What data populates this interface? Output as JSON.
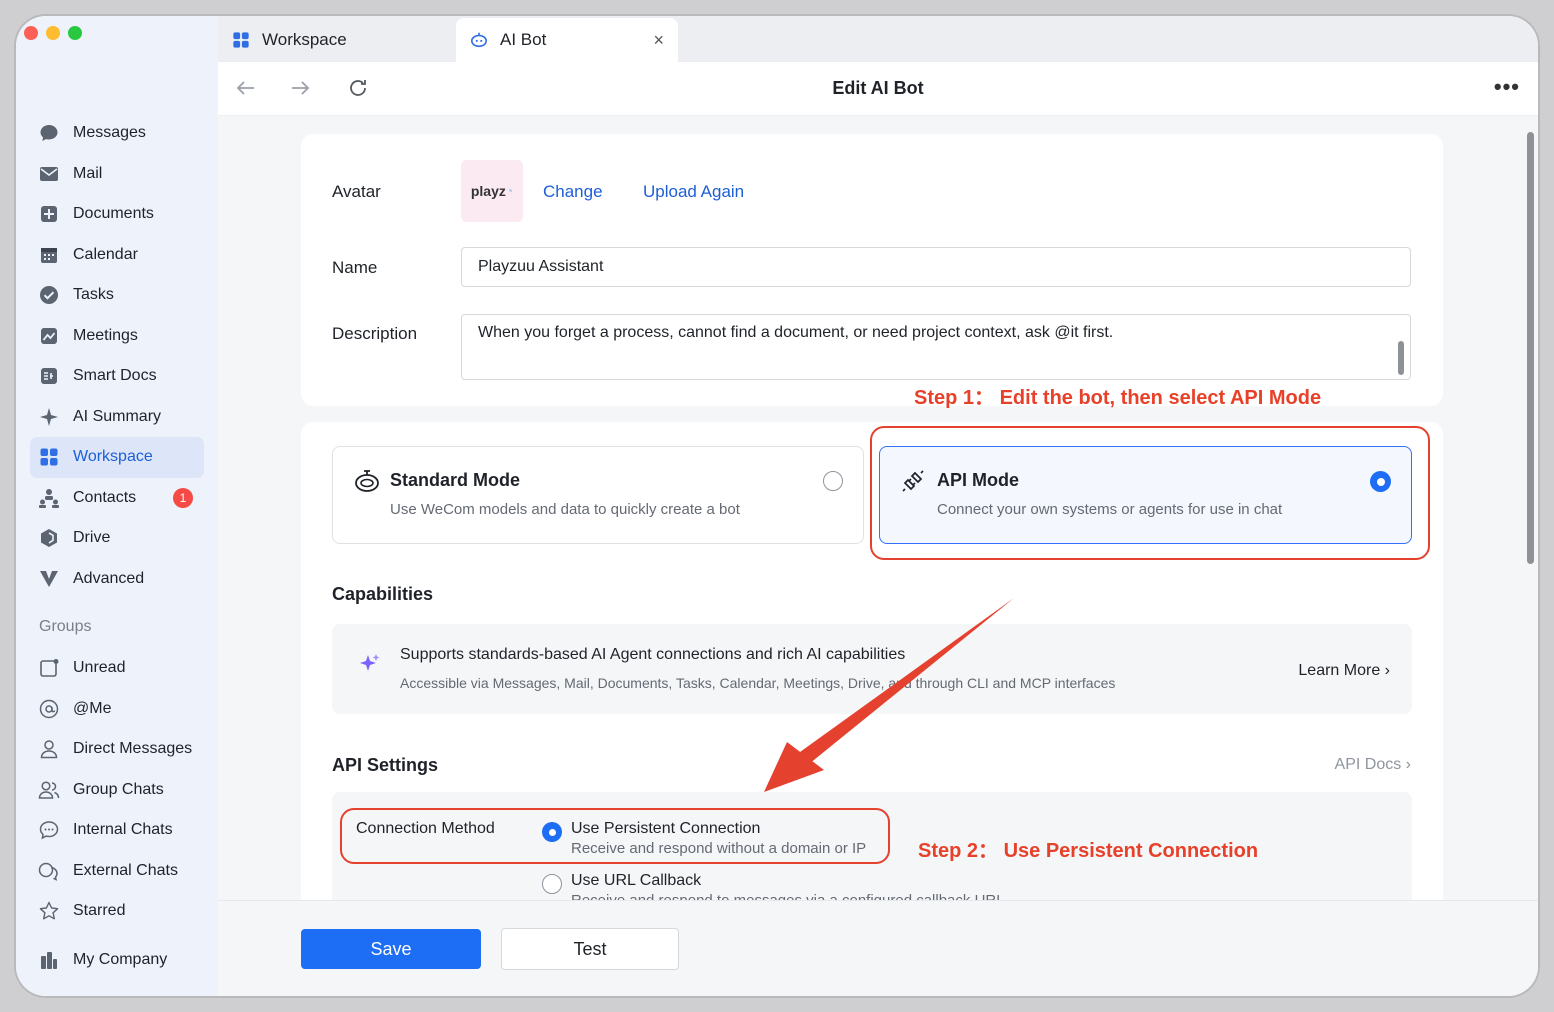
{
  "tabs": [
    {
      "label": "Workspace",
      "icon": "grid-icon"
    },
    {
      "label": "AI Bot",
      "icon": "bot-icon",
      "close": "×"
    }
  ],
  "toolbar": {
    "title": "Edit AI Bot",
    "more": "•••"
  },
  "sidebar": {
    "items": [
      {
        "label": "Messages",
        "icon": "chat-bubble-icon"
      },
      {
        "label": "Mail",
        "icon": "mail-icon"
      },
      {
        "label": "Documents",
        "icon": "document-icon"
      },
      {
        "label": "Calendar",
        "icon": "calendar-icon"
      },
      {
        "label": "Tasks",
        "icon": "check-circle-icon"
      },
      {
        "label": "Meetings",
        "icon": "meetings-icon"
      },
      {
        "label": "Smart Docs",
        "icon": "smart-docs-icon"
      },
      {
        "label": "AI Summary",
        "icon": "sparkle-icon"
      },
      {
        "label": "Workspace",
        "icon": "grid-icon",
        "active": true
      },
      {
        "label": "Contacts",
        "icon": "contacts-icon",
        "badge": "1"
      },
      {
        "label": "Drive",
        "icon": "drive-icon"
      },
      {
        "label": "Advanced",
        "icon": "advanced-icon"
      }
    ],
    "groups_title": "Groups",
    "groups": [
      {
        "label": "Unread",
        "icon": "unread-icon"
      },
      {
        "label": "@Me",
        "icon": "at-icon"
      },
      {
        "label": "Direct Messages",
        "icon": "person-icon"
      },
      {
        "label": "Group Chats",
        "icon": "people-icon"
      },
      {
        "label": "Internal Chats",
        "icon": "chat-dots-icon"
      },
      {
        "label": "External Chats",
        "icon": "external-chat-icon"
      },
      {
        "label": "Starred",
        "icon": "star-icon"
      }
    ],
    "company": {
      "label": "My Company",
      "icon": "company-icon"
    }
  },
  "form": {
    "avatar_label": "Avatar",
    "avatar_text": "playz",
    "change": "Change",
    "upload_again": "Upload Again",
    "name_label": "Name",
    "name_value": "Playzuu Assistant",
    "description_label": "Description",
    "description_value": "When you forget a process, cannot find a document, or need project context, ask @it first."
  },
  "modes": {
    "standard": {
      "title": "Standard Mode",
      "desc": "Use WeCom models and data to quickly create a bot",
      "selected": false
    },
    "api": {
      "title": "API Mode",
      "desc": "Connect your own systems or agents for use in chat",
      "selected": true
    }
  },
  "capabilities": {
    "title": "Capabilities",
    "headline": "Supports standards-based AI Agent connections and rich AI capabilities",
    "desc": "Accessible via Messages, Mail, Documents, Tasks, Calendar, Meetings, Drive, and through CLI and MCP interfaces",
    "learn_more": "Learn More ›"
  },
  "api_settings": {
    "title": "API Settings",
    "docs": "API Docs ›",
    "connection_label": "Connection Method",
    "options": [
      {
        "title": "Use Persistent Connection",
        "desc": "Receive and respond without a domain or IP",
        "selected": true
      },
      {
        "title": "Use URL Callback",
        "desc": "Receive and respond to messages via a configured callback URL",
        "selected": false
      }
    ]
  },
  "footer": {
    "save": "Save",
    "test": "Test"
  },
  "annotations": {
    "step1": "Step 1： Edit the bot, then select API Mode",
    "step2": "Step 2： Use Persistent Connection"
  },
  "colors": {
    "accent": "#1d6ef5",
    "annotation": "#e4412e",
    "badge": "#f54a45"
  }
}
